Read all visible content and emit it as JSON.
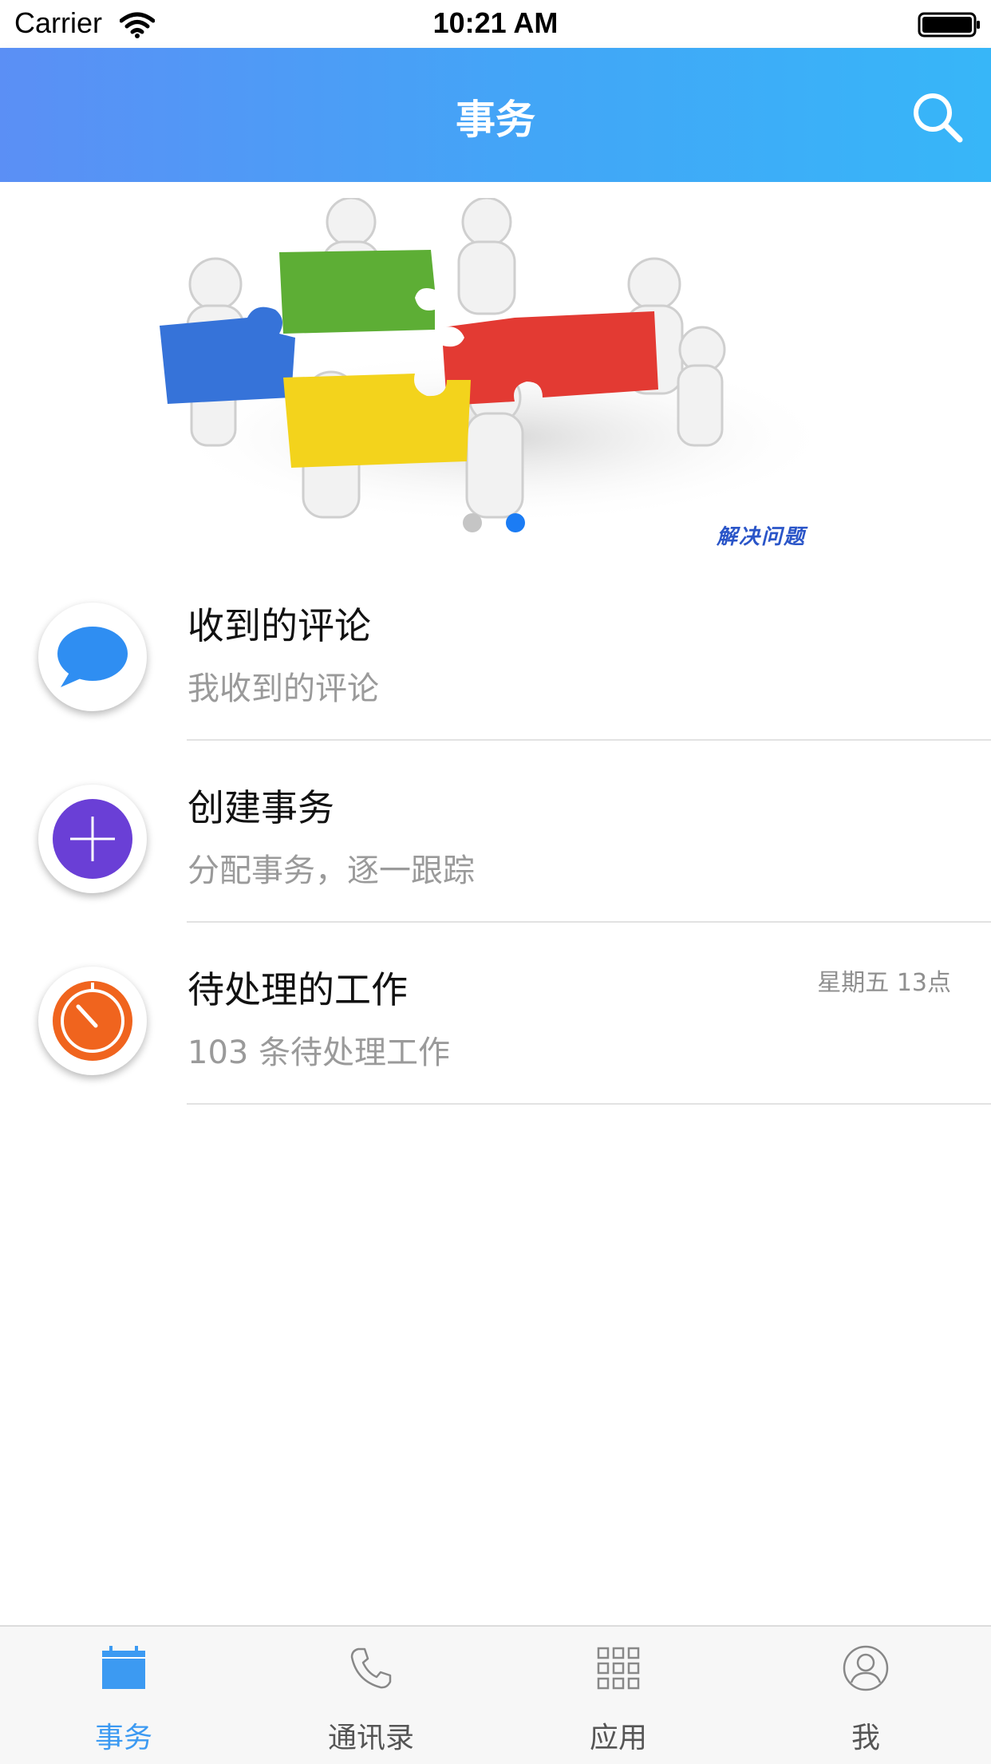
{
  "status_bar": {
    "carrier": "Carrier",
    "time": "10:21 AM"
  },
  "nav_bar": {
    "title": "事务",
    "search_icon": "search-icon"
  },
  "banner": {
    "caption": "解决问题",
    "page_count": 2,
    "active_page": 2
  },
  "list": {
    "items": [
      {
        "title": "收到的评论",
        "subtitle": "我收到的评论",
        "time": "",
        "icon": "comment-bubble-icon",
        "icon_color": "#2f8ef2"
      },
      {
        "title": "创建事务",
        "subtitle": "分配事务，逐一跟踪",
        "time": "",
        "icon": "plus-circle-icon",
        "icon_color": "#6a3fd6"
      },
      {
        "title": "待处理的工作",
        "subtitle": "103 条待处理工作",
        "time": "星期五 13点",
        "icon": "timer-icon",
        "icon_color": "#f0641e"
      }
    ]
  },
  "tab_bar": {
    "tabs": [
      {
        "label": "事务",
        "icon": "calendar-icon",
        "active": true
      },
      {
        "label": "通讯录",
        "icon": "phone-icon",
        "active": false
      },
      {
        "label": "应用",
        "icon": "grid-icon",
        "active": false
      },
      {
        "label": "我",
        "icon": "user-icon",
        "active": false
      }
    ]
  },
  "colors": {
    "accent": "#3c9af2",
    "nav_gradient_start": "#5b8ff5",
    "nav_gradient_end": "#37b6f8"
  }
}
